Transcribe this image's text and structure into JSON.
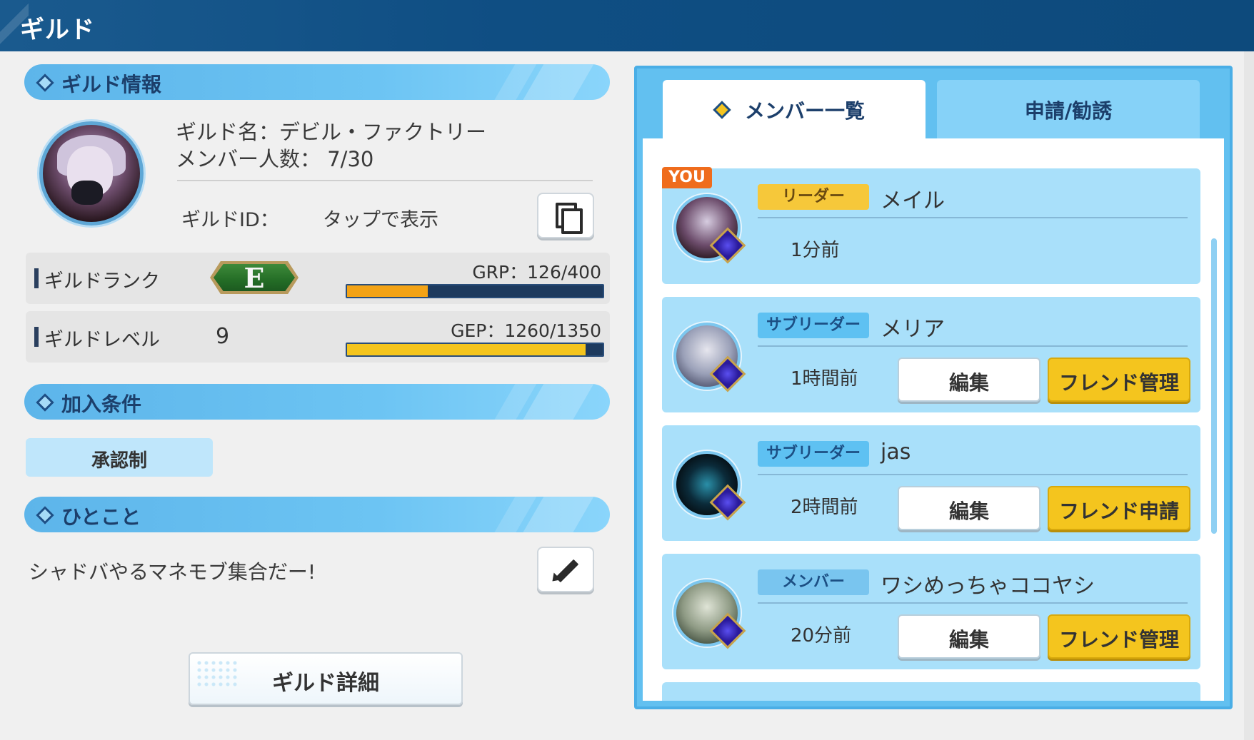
{
  "header": {
    "title": "ギルド"
  },
  "sections": {
    "guild_info": "ギルド情報",
    "join_conditions": "加入条件",
    "comment": "ひとこと"
  },
  "guild": {
    "name_line": "ギルド名：デビル・ファクトリー",
    "members_line": "メンバー人数： 7/30",
    "id_label": "ギルドID：",
    "id_value": "タップで表示",
    "rank_label": "ギルドランク",
    "rank_letter": "E",
    "grp_label": "GRP：126/400",
    "grp_progress": 0.315,
    "level_label": "ギルドレベル",
    "level_value": "9",
    "gep_label": "GEP：1260/1350",
    "gep_progress": 0.933,
    "join_condition": "承認制",
    "comment_text": "シャドバやるマネモブ集合だー!",
    "detail_button": "ギルド詳細"
  },
  "tabs": {
    "members": "メンバー一覧",
    "requests": "申請/勧誘"
  },
  "members": [
    {
      "you_badge": "YOU",
      "role": "リーダー",
      "name": "メイル",
      "last": "1分前"
    },
    {
      "role": "サブリーダー",
      "name": "メリア",
      "last": "1時間前",
      "edit": "編集",
      "friend": "フレンド管理"
    },
    {
      "role": "サブリーダー",
      "name": "jas",
      "last": "2時間前",
      "edit": "編集",
      "friend": "フレンド申請"
    },
    {
      "role": "メンバー",
      "name": "ワシめっちゃココヤシ",
      "last": "20分前",
      "edit": "編集",
      "friend": "フレンド管理"
    }
  ],
  "colors": {
    "grp_fill": "#f3a316",
    "gep_fill": "#f4c51e",
    "leader_role_bg": "#f6c83a",
    "sub_role_bg": "#5ec1f2",
    "member_role_bg": "#79c5ef"
  }
}
